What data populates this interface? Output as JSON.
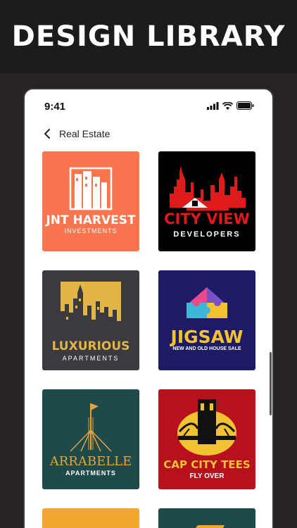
{
  "banner": {
    "title": "DESIGN LIBRARY"
  },
  "status": {
    "time": "9:41"
  },
  "nav": {
    "title": "Real Estate"
  },
  "colors": {
    "jnt_bg": "#f9754f",
    "cityview_bg": "#000000",
    "luxurious_bg": "#3b3a3f",
    "jigsaw_bg": "#1d1a66",
    "arrabelle_bg": "#1f4a4a",
    "capcity_bg": "#b6111c"
  },
  "cards": [
    {
      "name": "JNT HARVEST",
      "sub": "INVESTMENTS"
    },
    {
      "name": "CITY VIEW",
      "sub": "DEVELOPERS"
    },
    {
      "name": "LUXURIOUS",
      "sub": "APARTMENTS"
    },
    {
      "name": "JIGSAW",
      "sub": "NEW AND OLD HOUSE SALE"
    },
    {
      "name": "ARRABELLE",
      "sub": "APARTMENTS"
    },
    {
      "name": "CAP CITY TEES",
      "sub": "FLY OVER"
    }
  ]
}
